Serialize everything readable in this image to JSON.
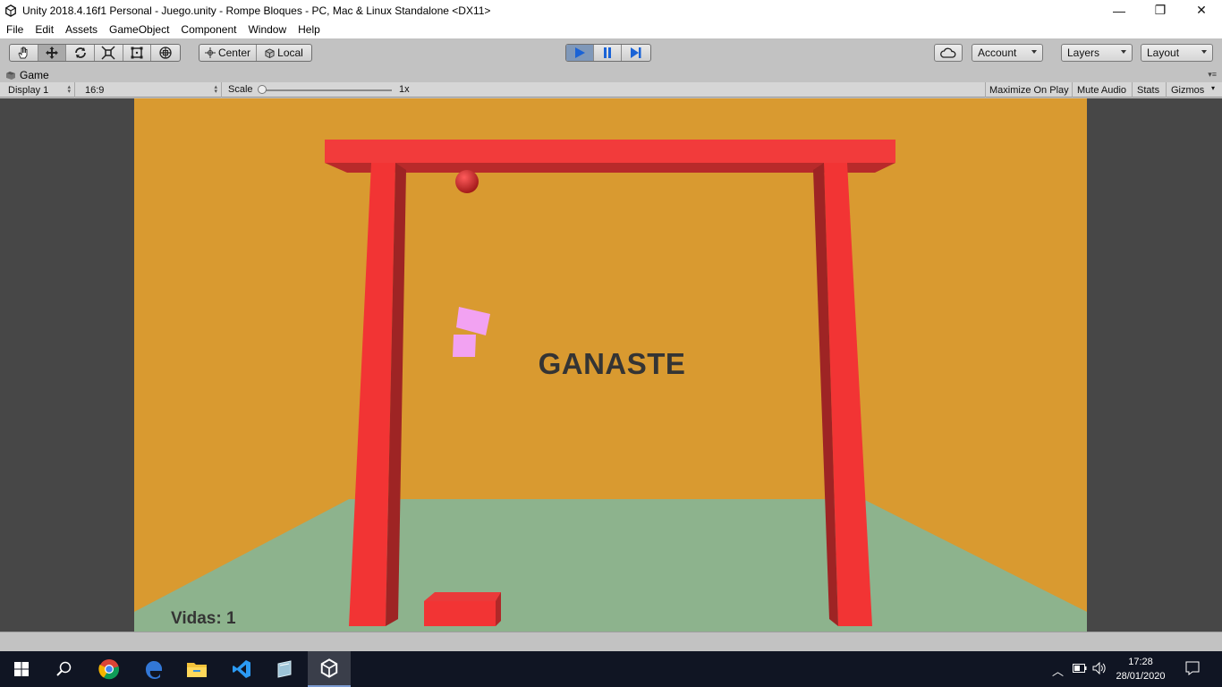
{
  "window": {
    "title": "Unity 2018.4.16f1 Personal - Juego.unity - Rompe Bloques - PC, Mac & Linux Standalone <DX11>",
    "minimize": "—",
    "maximize": "❐",
    "close": "✕"
  },
  "menu": [
    "File",
    "Edit",
    "Assets",
    "GameObject",
    "Component",
    "Window",
    "Help"
  ],
  "toolbar": {
    "tools": [
      "hand-tool",
      "move-tool",
      "rotate-tool",
      "scale-tool",
      "rect-tool",
      "transform-tool"
    ],
    "pivot_label": "Center",
    "space_label": "Local",
    "account_label": "Account",
    "layers_label": "Layers",
    "layout_label": "Layout"
  },
  "game_tab": {
    "label": "Game",
    "display": "Display 1",
    "aspect": "16:9",
    "scale_label": "Scale",
    "scale_value": "1x",
    "maximize_on_play": "Maximize On Play",
    "mute_audio": "Mute Audio",
    "stats": "Stats",
    "gizmos": "Gizmos"
  },
  "game": {
    "message": "GANASTE",
    "lives": "Vidas: 1",
    "colors": {
      "background": "#d99a30",
      "floor": "#8db38d",
      "frame": "#f23434",
      "ball": "#d42424",
      "blocks": "#f2a2f2"
    }
  },
  "taskbar": {
    "apps": [
      "start-icon",
      "search-icon",
      "chrome-icon",
      "edge-icon",
      "file-explorer-icon",
      "vscode-icon",
      "glass-app-icon",
      "unity-icon"
    ],
    "time": "17:28",
    "date": "28/01/2020"
  }
}
